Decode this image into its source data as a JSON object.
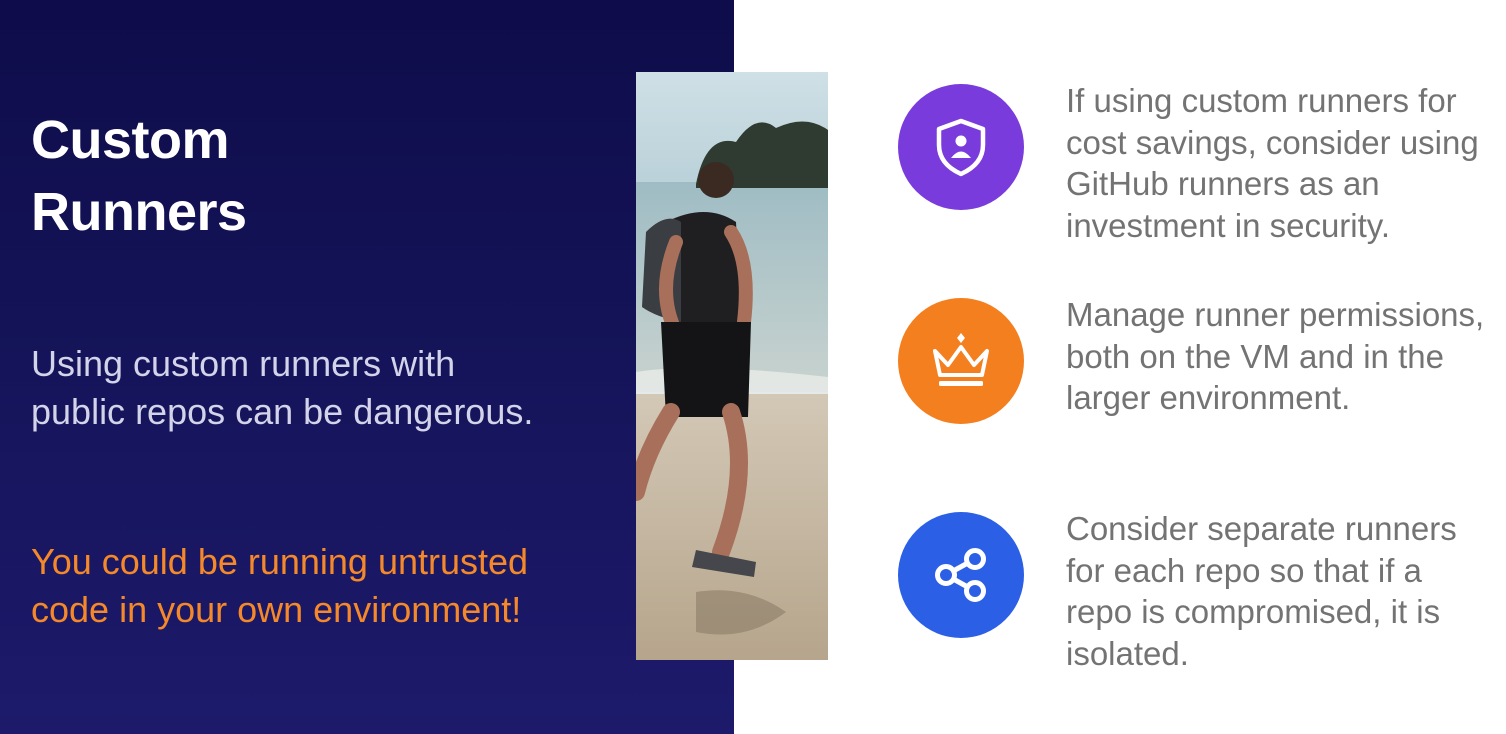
{
  "slide": {
    "title_line1": "Custom",
    "title_line2": "Runners",
    "subtitle": "Using custom runners with public repos can be dangerous.",
    "warning": "You could be running untrusted code in your own environment!",
    "colors": {
      "background_left": "#14135a",
      "background_right": "#ffffff",
      "warning_text": "#f5892a",
      "body_text": "#737373"
    },
    "image": {
      "icon": "photo-runner-beach"
    },
    "items": [
      {
        "text": "If using custom runners for cost savings, consider using GitHub runners as an investment in security.",
        "icon": "shield-user-icon",
        "color": "#7a3bdc"
      },
      {
        "text": "Manage runner permissions, both on the VM and in the larger environment.",
        "icon": "crown-icon",
        "color": "#f47f1f"
      },
      {
        "text": "Consider separate runners for each repo so that if a repo is compromised, it is isolated.",
        "icon": "share-icon",
        "color": "#2b5fe6"
      }
    ]
  }
}
